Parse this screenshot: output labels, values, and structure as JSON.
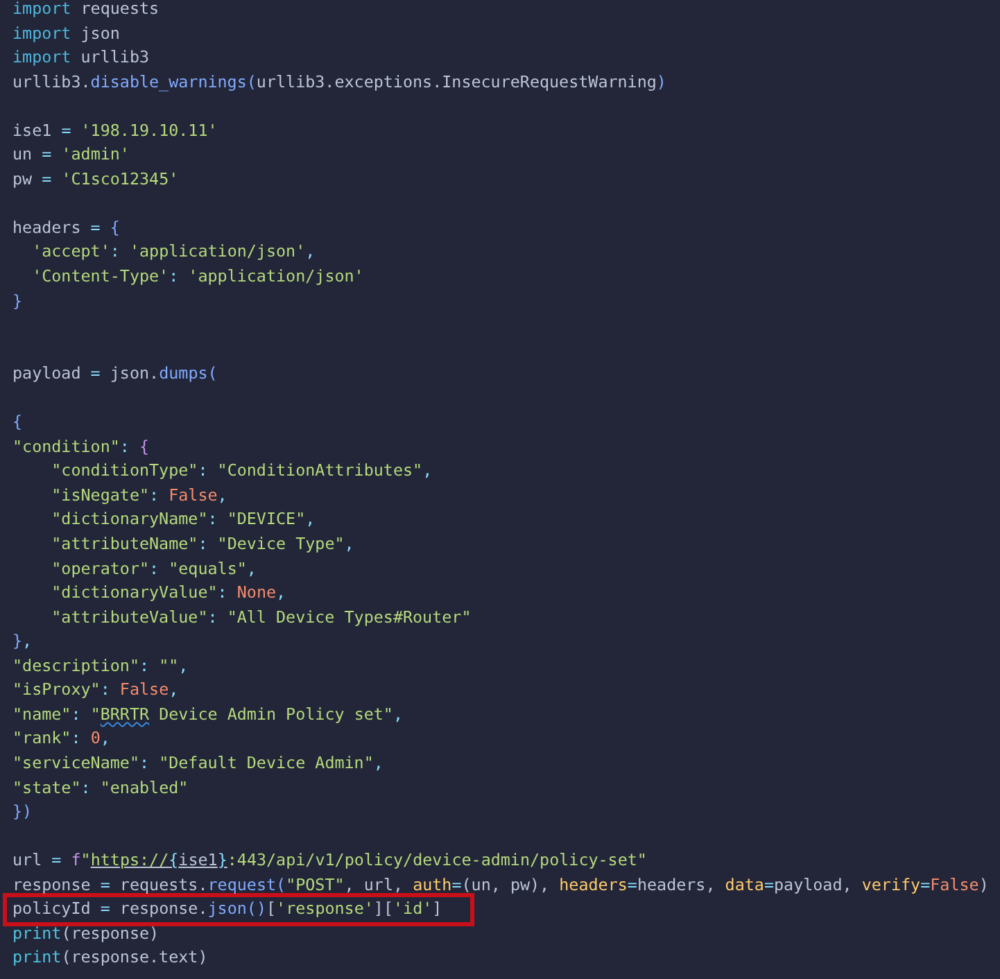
{
  "editor": {
    "lines": [
      {
        "kind": "code",
        "tokens": [
          {
            "kind": "keyword",
            "text": "import"
          },
          {
            "kind": "plain",
            "text": " requests"
          }
        ]
      },
      {
        "kind": "code",
        "tokens": [
          {
            "kind": "keyword",
            "text": "import"
          },
          {
            "kind": "plain",
            "text": " json"
          }
        ]
      },
      {
        "kind": "code",
        "tokens": [
          {
            "kind": "keyword",
            "text": "import"
          },
          {
            "kind": "plain",
            "text": " urllib3"
          }
        ]
      },
      {
        "kind": "code",
        "tokens": [
          {
            "kind": "plain",
            "text": "urllib3."
          },
          {
            "kind": "function",
            "text": "disable_warnings("
          },
          {
            "kind": "plain",
            "text": "urllib3.exceptions.InsecureRequestWarning"
          },
          {
            "kind": "function",
            "text": ")"
          }
        ]
      },
      {
        "kind": "blank"
      },
      {
        "kind": "code",
        "tokens": [
          {
            "kind": "plain",
            "text": "ise1 "
          },
          {
            "kind": "operator",
            "text": "="
          },
          {
            "kind": "string",
            "text": " '198.19.10.11'"
          }
        ]
      },
      {
        "kind": "code",
        "tokens": [
          {
            "kind": "plain",
            "text": "un "
          },
          {
            "kind": "operator",
            "text": "="
          },
          {
            "kind": "string",
            "text": " 'admin'"
          }
        ]
      },
      {
        "kind": "code",
        "tokens": [
          {
            "kind": "plain",
            "text": "pw "
          },
          {
            "kind": "operator",
            "text": "="
          },
          {
            "kind": "string",
            "text": " 'C1sco12345'"
          }
        ]
      },
      {
        "kind": "blank"
      },
      {
        "kind": "code",
        "tokens": [
          {
            "kind": "plain",
            "text": "headers "
          },
          {
            "kind": "operator",
            "text": "="
          },
          {
            "kind": "function",
            "text": " {"
          }
        ]
      },
      {
        "kind": "code",
        "tokens": [
          {
            "kind": "string",
            "text": "  'accept'"
          },
          {
            "kind": "operator",
            "text": ":"
          },
          {
            "kind": "string",
            "text": " 'application/json'"
          },
          {
            "kind": "operator",
            "text": ","
          }
        ]
      },
      {
        "kind": "code",
        "tokens": [
          {
            "kind": "string",
            "text": "  'Content-Type'"
          },
          {
            "kind": "operator",
            "text": ":"
          },
          {
            "kind": "string",
            "text": " 'application/json'"
          }
        ]
      },
      {
        "kind": "code",
        "tokens": [
          {
            "kind": "function",
            "text": "}"
          }
        ]
      },
      {
        "kind": "blank"
      },
      {
        "kind": "blank"
      },
      {
        "kind": "code",
        "tokens": [
          {
            "kind": "plain",
            "text": "payload "
          },
          {
            "kind": "operator",
            "text": "="
          },
          {
            "kind": "plain",
            "text": " json."
          },
          {
            "kind": "function",
            "text": "dumps("
          }
        ]
      },
      {
        "kind": "blank"
      },
      {
        "kind": "code",
        "tokens": [
          {
            "kind": "function",
            "text": "{"
          }
        ]
      },
      {
        "kind": "code",
        "tokens": [
          {
            "kind": "string",
            "text": "\"condition\""
          },
          {
            "kind": "operator",
            "text": ":"
          },
          {
            "kind": "brace",
            "text": " {"
          }
        ]
      },
      {
        "kind": "code",
        "tokens": [
          {
            "kind": "string",
            "text": "    \"conditionType\""
          },
          {
            "kind": "operator",
            "text": ":"
          },
          {
            "kind": "string",
            "text": " \"ConditionAttributes\""
          },
          {
            "kind": "operator",
            "text": ","
          }
        ]
      },
      {
        "kind": "code",
        "tokens": [
          {
            "kind": "string",
            "text": "    \"isNegate\""
          },
          {
            "kind": "operator",
            "text": ":"
          },
          {
            "kind": "number",
            "text": " False"
          },
          {
            "kind": "operator",
            "text": ","
          }
        ]
      },
      {
        "kind": "code",
        "tokens": [
          {
            "kind": "string",
            "text": "    \"dictionaryName\""
          },
          {
            "kind": "operator",
            "text": ":"
          },
          {
            "kind": "string",
            "text": " \"DEVICE\""
          },
          {
            "kind": "operator",
            "text": ","
          }
        ]
      },
      {
        "kind": "code",
        "tokens": [
          {
            "kind": "string",
            "text": "    \"attributeName\""
          },
          {
            "kind": "operator",
            "text": ":"
          },
          {
            "kind": "string",
            "text": " \"Device Type\""
          },
          {
            "kind": "operator",
            "text": ","
          }
        ]
      },
      {
        "kind": "code",
        "tokens": [
          {
            "kind": "string",
            "text": "    \"operator\""
          },
          {
            "kind": "operator",
            "text": ":"
          },
          {
            "kind": "string",
            "text": " \"equals\""
          },
          {
            "kind": "operator",
            "text": ","
          }
        ]
      },
      {
        "kind": "code",
        "tokens": [
          {
            "kind": "string",
            "text": "    \"dictionaryValue\""
          },
          {
            "kind": "operator",
            "text": ":"
          },
          {
            "kind": "number",
            "text": " None"
          },
          {
            "kind": "operator",
            "text": ","
          }
        ]
      },
      {
        "kind": "code",
        "tokens": [
          {
            "kind": "string",
            "text": "    \"attributeValue\""
          },
          {
            "kind": "operator",
            "text": ":"
          },
          {
            "kind": "string",
            "text": " \"All Device Types#Router\""
          }
        ]
      },
      {
        "kind": "code",
        "tokens": [
          {
            "kind": "function",
            "text": "}"
          },
          {
            "kind": "operator",
            "text": ","
          }
        ]
      },
      {
        "kind": "code",
        "tokens": [
          {
            "kind": "string",
            "text": "\"description\""
          },
          {
            "kind": "operator",
            "text": ":"
          },
          {
            "kind": "string",
            "text": " \"\""
          },
          {
            "kind": "operator",
            "text": ","
          }
        ]
      },
      {
        "kind": "code",
        "tokens": [
          {
            "kind": "string",
            "text": "\"isProxy\""
          },
          {
            "kind": "operator",
            "text": ":"
          },
          {
            "kind": "number",
            "text": " False"
          },
          {
            "kind": "operator",
            "text": ","
          }
        ]
      },
      {
        "kind": "code",
        "tokens": [
          {
            "kind": "string",
            "text": "\"name\""
          },
          {
            "kind": "operator",
            "text": ":"
          },
          {
            "kind": "string",
            "text": " \""
          },
          {
            "kind": "string",
            "text": "BRRTR",
            "spellcheck": true
          },
          {
            "kind": "string",
            "text": " Device Admin Policy set\""
          },
          {
            "kind": "operator",
            "text": ","
          }
        ]
      },
      {
        "kind": "code",
        "tokens": [
          {
            "kind": "string",
            "text": "\"rank\""
          },
          {
            "kind": "operator",
            "text": ":"
          },
          {
            "kind": "number",
            "text": " 0"
          },
          {
            "kind": "operator",
            "text": ","
          }
        ]
      },
      {
        "kind": "code",
        "tokens": [
          {
            "kind": "string",
            "text": "\"serviceName\""
          },
          {
            "kind": "operator",
            "text": ":"
          },
          {
            "kind": "string",
            "text": " \"Default Device Admin\""
          },
          {
            "kind": "operator",
            "text": ","
          }
        ]
      },
      {
        "kind": "code",
        "tokens": [
          {
            "kind": "string",
            "text": "\"state\""
          },
          {
            "kind": "operator",
            "text": ":"
          },
          {
            "kind": "string",
            "text": " \"enabled\""
          }
        ]
      },
      {
        "kind": "code",
        "tokens": [
          {
            "kind": "function",
            "text": "})"
          }
        ]
      },
      {
        "kind": "blank"
      },
      {
        "kind": "code",
        "tokens": [
          {
            "kind": "plain",
            "text": "url "
          },
          {
            "kind": "operator",
            "text": "="
          },
          {
            "kind": "brace",
            "text": " f"
          },
          {
            "kind": "string",
            "text": "\""
          },
          {
            "kind": "string",
            "text": "https://",
            "link": true
          },
          {
            "kind": "operator",
            "text": "{",
            "link": true
          },
          {
            "kind": "plain",
            "text": "ise1",
            "link": true
          },
          {
            "kind": "operator",
            "text": "}",
            "link": true
          },
          {
            "kind": "string",
            "text": ":443/api/v1/policy/device-admin/policy-set\""
          }
        ]
      },
      {
        "kind": "code",
        "tokens": [
          {
            "kind": "plain",
            "text": "response "
          },
          {
            "kind": "operator",
            "text": "="
          },
          {
            "kind": "plain",
            "text": " requests."
          },
          {
            "kind": "function",
            "text": "request("
          },
          {
            "kind": "string",
            "text": "\"POST\""
          },
          {
            "kind": "plain",
            "text": ", url, "
          },
          {
            "kind": "parameter",
            "text": "auth"
          },
          {
            "kind": "operator",
            "text": "="
          },
          {
            "kind": "plain",
            "text": "(un, pw), "
          },
          {
            "kind": "parameter",
            "text": "headers"
          },
          {
            "kind": "operator",
            "text": "="
          },
          {
            "kind": "plain",
            "text": "headers, "
          },
          {
            "kind": "parameter",
            "text": "data"
          },
          {
            "kind": "operator",
            "text": "="
          },
          {
            "kind": "plain",
            "text": "payload, "
          },
          {
            "kind": "parameter",
            "text": "verify"
          },
          {
            "kind": "operator",
            "text": "="
          },
          {
            "kind": "number",
            "text": "False"
          },
          {
            "kind": "plain",
            "text": ")"
          }
        ]
      },
      {
        "kind": "code",
        "highlighted": true,
        "tokens": [
          {
            "kind": "plain",
            "text": "policyId "
          },
          {
            "kind": "operator",
            "text": "="
          },
          {
            "kind": "plain",
            "text": " response."
          },
          {
            "kind": "function",
            "text": "json()"
          },
          {
            "kind": "plain",
            "text": "["
          },
          {
            "kind": "string",
            "text": "'response'"
          },
          {
            "kind": "plain",
            "text": "]["
          },
          {
            "kind": "string",
            "text": "'id'"
          },
          {
            "kind": "plain",
            "text": "]"
          }
        ]
      },
      {
        "kind": "code",
        "tokens": [
          {
            "kind": "builtin",
            "text": "print"
          },
          {
            "kind": "plain",
            "text": "(response)"
          }
        ]
      },
      {
        "kind": "code",
        "tokens": [
          {
            "kind": "builtin",
            "text": "print"
          },
          {
            "kind": "plain",
            "text": "(response.text)"
          }
        ]
      }
    ]
  }
}
